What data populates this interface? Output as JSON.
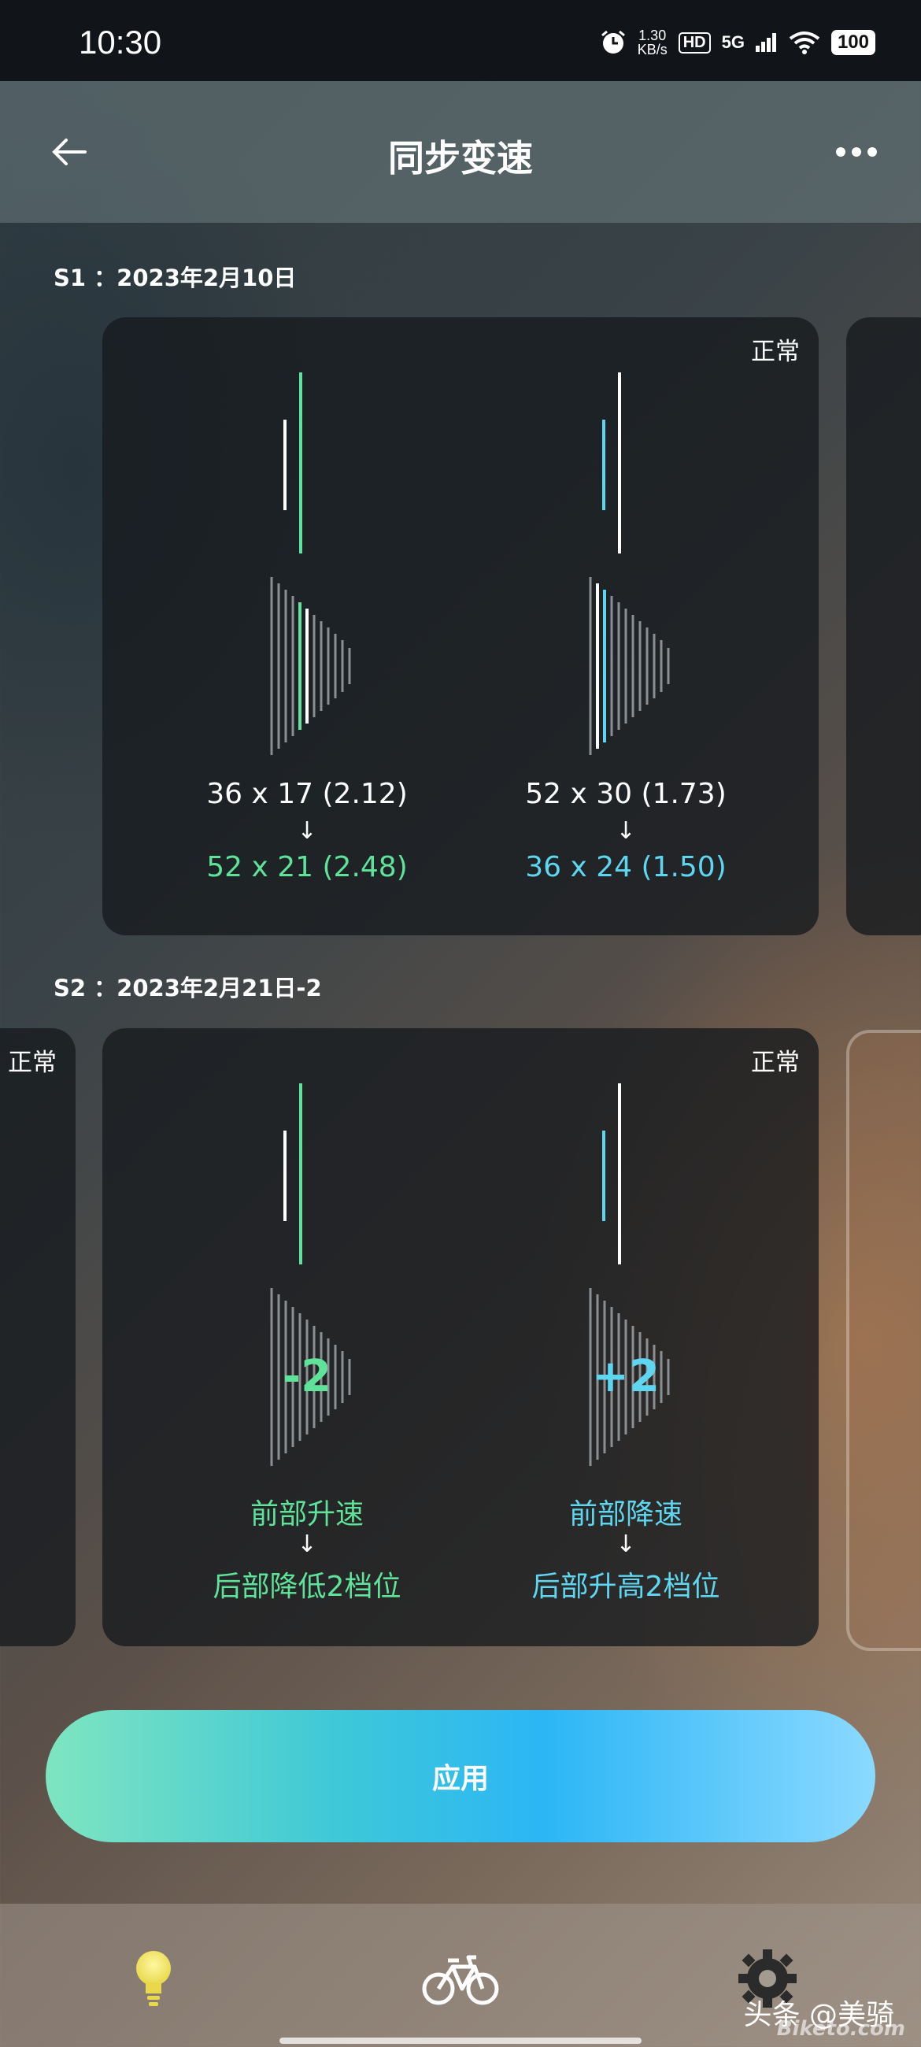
{
  "status_bar": {
    "time": "10:30",
    "net_speed_value": "1.30",
    "net_speed_unit": "KB/s",
    "hd_badge": "HD",
    "network": "5G",
    "battery": "100",
    "icons": [
      "alarm-icon",
      "signal-icon",
      "wifi-icon",
      "battery-icon"
    ]
  },
  "header": {
    "title": "同步变速",
    "back_icon": "arrow-left-icon",
    "more_icon": "more-horizontal-icon"
  },
  "sections": [
    {
      "title": "S1 ：2023年2月10日",
      "card": {
        "status": "正常",
        "left": {
          "from": "36 x 17 (2.12)",
          "arrow": "↓",
          "to": "52 x 21 (2.48)",
          "color": "#5fe39a"
        },
        "right": {
          "from": "52 x 30 (1.73)",
          "arrow": "↓",
          "to": "36 x 24 (1.50)",
          "color": "#5fd6f0"
        }
      }
    },
    {
      "title": "S2 ：2023年2月21日-2",
      "prev_card_status": "正常",
      "card": {
        "status": "正常",
        "left": {
          "shift": "-2",
          "line1": "前部升速",
          "arrow": "↓",
          "line2": "后部降低2档位",
          "color": "#5fe39a"
        },
        "right": {
          "shift": "+2",
          "line1": "前部降速",
          "arrow": "↓",
          "line2": "后部升高2档位",
          "color": "#5fd6f0"
        }
      }
    }
  ],
  "apply_button": "应用",
  "bottom_nav": {
    "items": [
      "bulb-icon",
      "bicycle-icon",
      "gear-icon"
    ],
    "active": "bulb-icon"
  },
  "watermark": {
    "text": "头条 @美骑",
    "sub": "Biketo.com"
  }
}
